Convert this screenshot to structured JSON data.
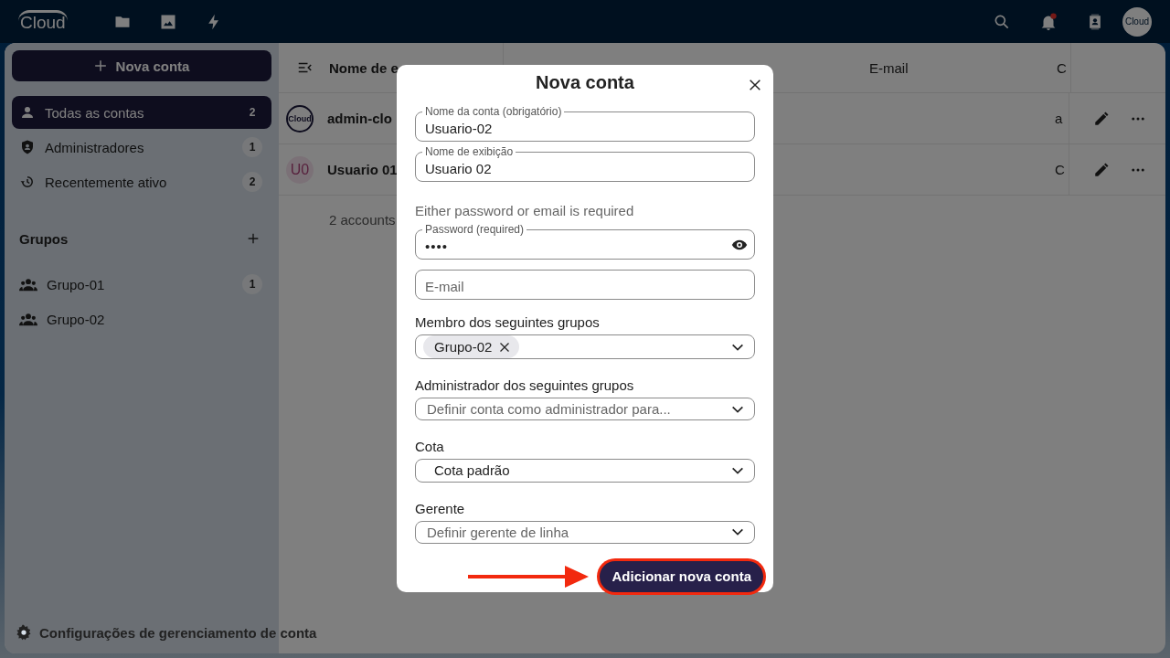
{
  "top_bar": {
    "logo": "Cloud",
    "avatar": "Cloud",
    "notification_unread": true
  },
  "sidebar": {
    "new_button": "Nova conta",
    "items": [
      {
        "label": "Todas as contas",
        "count": "2",
        "selected": true
      },
      {
        "label": "Administradores",
        "count": "1",
        "selected": false
      },
      {
        "label": "Recentemente ativo",
        "count": "2",
        "selected": false
      }
    ],
    "groups_heading": "Grupos",
    "groups": [
      {
        "label": "Grupo-01",
        "count": "1"
      },
      {
        "label": "Grupo-02"
      }
    ],
    "settings": "Configurações de gerenciamento de conta"
  },
  "table": {
    "columns": [
      "Nome de e",
      "E-mail",
      "C"
    ],
    "rows": [
      {
        "kind": "logo",
        "avatar": "Cloud",
        "name": "admin-clo",
        "column_5": "a"
      },
      {
        "kind": "initials",
        "avatar": "U0",
        "name": "Usuario 01",
        "column_5": "C"
      }
    ],
    "footer": "2 accounts"
  },
  "dialog": {
    "title": "Nova conta",
    "fields": [
      {
        "kind": "input",
        "label": "Nome da conta (obrigatório)",
        "value": "Usuario-02"
      },
      {
        "kind": "input",
        "label": "Nome de exibição",
        "value": "Usuario 02"
      },
      {
        "kind": "note",
        "text": "Either password or email is required"
      },
      {
        "kind": "password",
        "label": "Password (required)",
        "value": "••••"
      },
      {
        "kind": "input",
        "placeholder": "E-mail"
      },
      {
        "kind": "select",
        "label": "Membro dos seguintes grupos",
        "tags": [
          "Grupo-02"
        ]
      },
      {
        "kind": "select",
        "label": "Administrador dos seguintes grupos",
        "placeholder": "Definir conta como administrador para..."
      },
      {
        "kind": "select",
        "label": "Cota",
        "value": "Cota padrão"
      },
      {
        "kind": "select",
        "label": "Gerente",
        "placeholder": "Definir gerente de linha"
      }
    ],
    "submit": "Adicionar nova conta",
    "submit_highlighted": true
  }
}
